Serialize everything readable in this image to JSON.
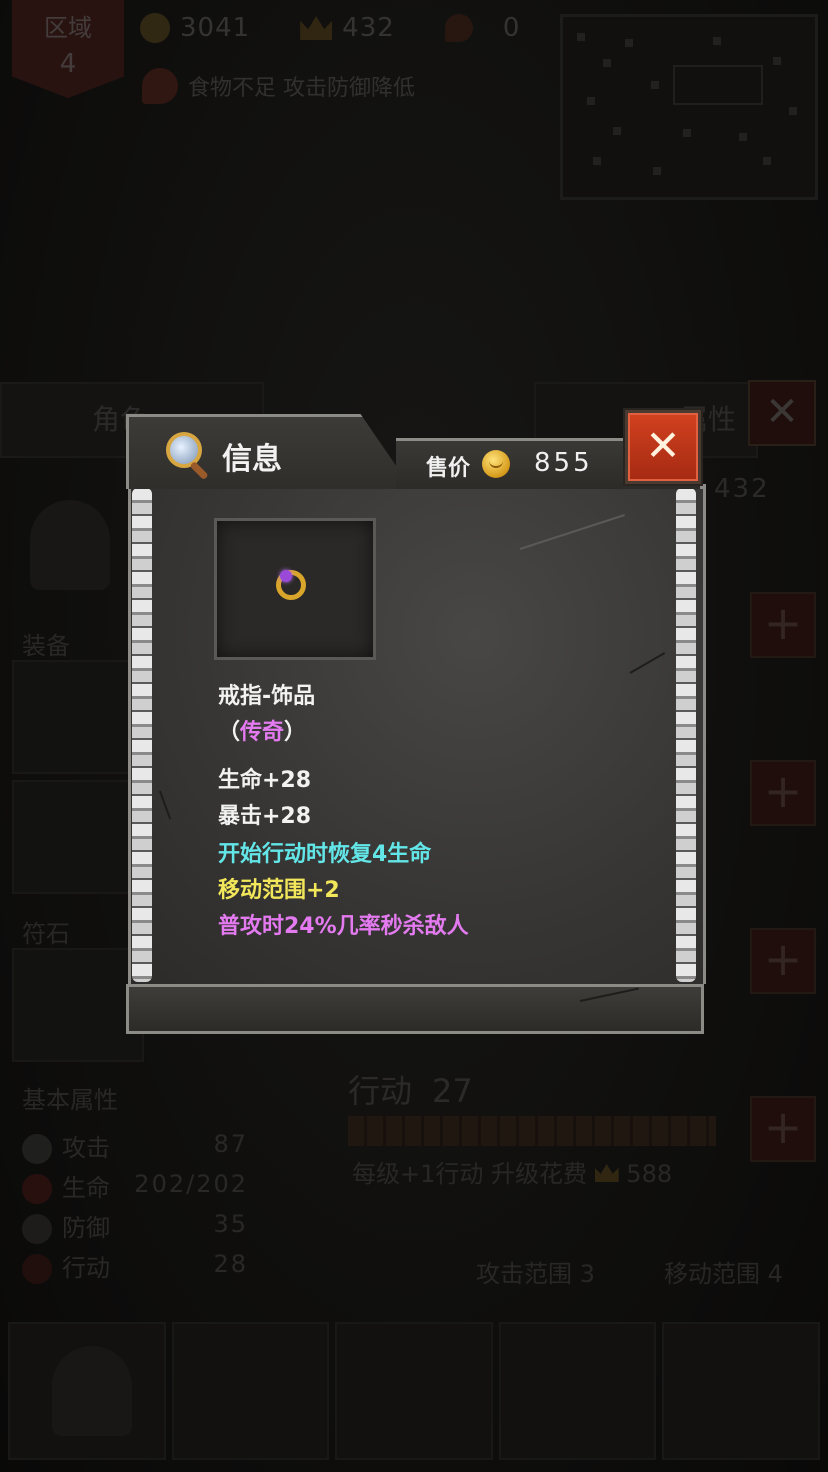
{
  "hud": {
    "region_label": "区域",
    "region_value": "4",
    "coins": "3041",
    "crowns": "432",
    "meat": "0",
    "warning": "食物不足 攻击防御降低"
  },
  "background_panel": {
    "tab_left": "角色",
    "tab_right": "属性",
    "close_glyph": "✕",
    "crowns": "432",
    "equip_label": "装备",
    "rune_label": "符石",
    "base_attr_label": "基本属性",
    "attributes": [
      {
        "name": "攻击",
        "value": "87"
      },
      {
        "name": "生命",
        "value": "202/202"
      },
      {
        "name": "防御",
        "value": "35"
      },
      {
        "name": "行动",
        "value": "28"
      }
    ],
    "action_title": "行动",
    "action_value": "27",
    "action_sub": "每级+1行动  升级花费",
    "action_cost": "588",
    "attack_range": "攻击范围 3",
    "move_range": "移动范围 4",
    "plus_glyph": "+"
  },
  "popup": {
    "title": "信息",
    "price_label": "售价",
    "price_value": "855",
    "close_glyph": "✕",
    "item_type": "戒指-饰品",
    "rarity_open": "（",
    "rarity": "传奇",
    "rarity_close": "）",
    "stats": [
      "生命+28",
      "暴击+28"
    ],
    "effects": [
      {
        "text": "开始行动时恢复4生命",
        "color": "#63e6e8"
      },
      {
        "text": "移动范围+2",
        "color": "#f2e65a"
      },
      {
        "text": "普攻时24%几率秒杀敌人",
        "color": "#e47af0"
      }
    ]
  },
  "icons": {
    "magnifier": "magnifier-icon",
    "coin": "coin-icon",
    "ring": "ring-icon"
  }
}
